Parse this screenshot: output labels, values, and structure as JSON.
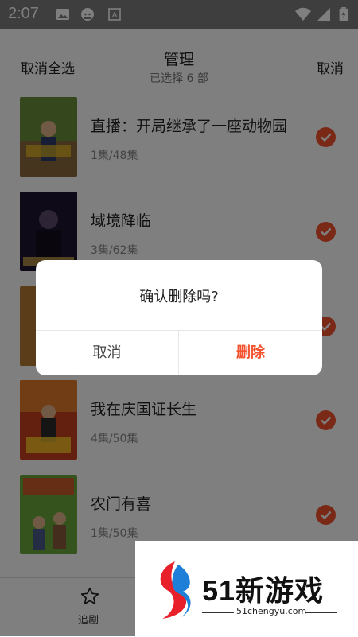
{
  "status": {
    "time": "2:07",
    "icons": [
      "image-icon",
      "face-icon",
      "a-box-icon",
      "wifi-icon",
      "signal-icon",
      "battery-icon"
    ]
  },
  "header": {
    "left": "取消全选",
    "title": "管理",
    "subtitle": "已选择 6 部",
    "right": "取消"
  },
  "items": [
    {
      "name": "直播：开局继承了一座动物园",
      "eps": "1集/48集"
    },
    {
      "name": "域境降临",
      "eps": "3集/62集"
    },
    {
      "name": "",
      "eps": ""
    },
    {
      "name": "我在庆国证长生",
      "eps": "4集/50集"
    },
    {
      "name": "农门有喜",
      "eps": "1集/50集"
    }
  ],
  "bottom_nav": {
    "label": "追剧"
  },
  "dialog": {
    "message": "确认删除吗?",
    "cancel": "取消",
    "confirm": "删除"
  },
  "watermark": {
    "brand": "51新游戏",
    "url": "51chengyu.com"
  },
  "colors": {
    "accent": "#f4522e",
    "overlay": "rgba(0,0,0,0.5)"
  }
}
